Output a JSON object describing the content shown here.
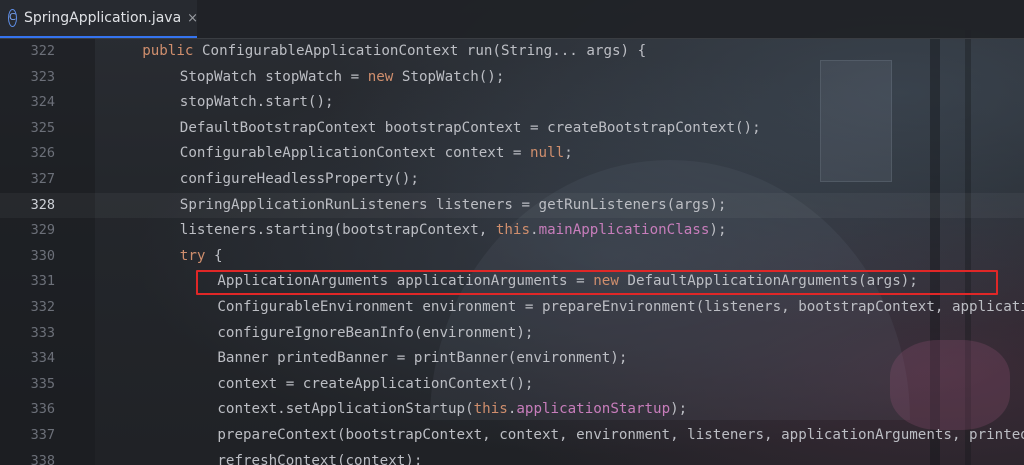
{
  "tab": {
    "icon": "class-c-icon",
    "icon_glyph": "C",
    "label": "SpringApplication.java",
    "close": "×"
  },
  "colors": {
    "keyword": "#cf8e6d",
    "field": "#c77dbb",
    "default_text": "#bcbec4",
    "line_number": "#6c7079",
    "highlight_box": "#e02727",
    "tab_underline": "#3574f0"
  },
  "highlighted_line": "331",
  "current_line": "328",
  "lines": [
    {
      "num": "322",
      "indent": 2,
      "segs": [
        {
          "t": "public ",
          "c": "kw"
        },
        {
          "t": "ConfigurableApplicationContext ",
          "c": ""
        },
        {
          "t": "run",
          "c": "fn"
        },
        {
          "t": "(String... args) {",
          "c": ""
        }
      ]
    },
    {
      "num": "323",
      "indent": 3,
      "segs": [
        {
          "t": "StopWatch stopWatch = ",
          "c": ""
        },
        {
          "t": "new ",
          "c": "kw"
        },
        {
          "t": "StopWatch();",
          "c": ""
        }
      ]
    },
    {
      "num": "324",
      "indent": 3,
      "segs": [
        {
          "t": "stopWatch.start();",
          "c": ""
        }
      ]
    },
    {
      "num": "325",
      "indent": 3,
      "segs": [
        {
          "t": "DefaultBootstrapContext bootstrapContext = createBootstrapContext();",
          "c": ""
        }
      ]
    },
    {
      "num": "326",
      "indent": 3,
      "segs": [
        {
          "t": "ConfigurableApplicationContext context = ",
          "c": ""
        },
        {
          "t": "null",
          "c": "kw"
        },
        {
          "t": ";",
          "c": ""
        }
      ]
    },
    {
      "num": "327",
      "indent": 3,
      "segs": [
        {
          "t": "configureHeadlessProperty();",
          "c": ""
        }
      ]
    },
    {
      "num": "328",
      "indent": 3,
      "segs": [
        {
          "t": "SpringApplicationRunListeners listeners = getRunListeners(args);",
          "c": ""
        }
      ]
    },
    {
      "num": "329",
      "indent": 3,
      "segs": [
        {
          "t": "listeners.starting(bootstrapContext, ",
          "c": ""
        },
        {
          "t": "this",
          "c": "kw"
        },
        {
          "t": ".",
          "c": ""
        },
        {
          "t": "mainApplicationClass",
          "c": "fld"
        },
        {
          "t": ");",
          "c": ""
        }
      ]
    },
    {
      "num": "330",
      "indent": 3,
      "segs": [
        {
          "t": "try ",
          "c": "kw"
        },
        {
          "t": "{",
          "c": ""
        }
      ]
    },
    {
      "num": "331",
      "indent": 4,
      "segs": [
        {
          "t": "ApplicationArguments applicationArguments = ",
          "c": ""
        },
        {
          "t": "new ",
          "c": "kw"
        },
        {
          "t": "DefaultApplicationArguments(args);",
          "c": ""
        }
      ]
    },
    {
      "num": "332",
      "indent": 4,
      "segs": [
        {
          "t": "ConfigurableEnvironment environment = prepareEnvironment(listeners, bootstrapContext, applicationArguments);",
          "c": ""
        }
      ]
    },
    {
      "num": "333",
      "indent": 4,
      "segs": [
        {
          "t": "configureIgnoreBeanInfo(environment);",
          "c": ""
        }
      ]
    },
    {
      "num": "334",
      "indent": 4,
      "segs": [
        {
          "t": "Banner printedBanner = printBanner(environment);",
          "c": ""
        }
      ]
    },
    {
      "num": "335",
      "indent": 4,
      "segs": [
        {
          "t": "context = createApplicationContext();",
          "c": ""
        }
      ]
    },
    {
      "num": "336",
      "indent": 4,
      "segs": [
        {
          "t": "context.setApplicationStartup(",
          "c": ""
        },
        {
          "t": "this",
          "c": "kw"
        },
        {
          "t": ".",
          "c": ""
        },
        {
          "t": "applicationStartup",
          "c": "fld"
        },
        {
          "t": ");",
          "c": ""
        }
      ]
    },
    {
      "num": "337",
      "indent": 4,
      "segs": [
        {
          "t": "prepareContext(bootstrapContext, context, environment, listeners, applicationArguments, printedBanner);",
          "c": ""
        }
      ]
    },
    {
      "num": "338",
      "indent": 4,
      "segs": [
        {
          "t": "refreshContext(context);",
          "c": ""
        }
      ]
    }
  ]
}
